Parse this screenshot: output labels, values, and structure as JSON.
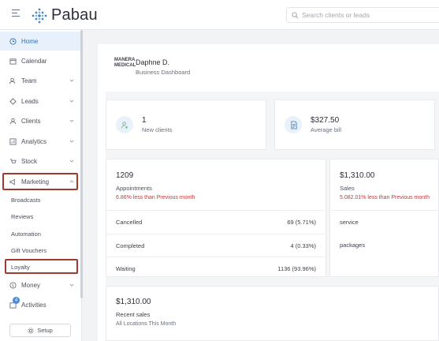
{
  "app": {
    "name": "Pabau"
  },
  "search": {
    "placeholder": "Search clients or leads"
  },
  "sidebar": {
    "items": [
      {
        "label": "Home",
        "icon": "home-icon"
      },
      {
        "label": "Calendar",
        "icon": "calendar-icon"
      },
      {
        "label": "Team",
        "icon": "team-icon"
      },
      {
        "label": "Leads",
        "icon": "leads-icon"
      },
      {
        "label": "Clients",
        "icon": "clients-icon"
      },
      {
        "label": "Analytics",
        "icon": "analytics-icon"
      },
      {
        "label": "Stock",
        "icon": "stock-icon"
      },
      {
        "label": "Marketing",
        "icon": "megaphone-icon"
      }
    ],
    "marketing_sub": [
      "Broadcasts",
      "Reviews",
      "Automation",
      "Gift Vouchers",
      "Loyalty"
    ],
    "money": {
      "label": "Money",
      "icon": "money-icon"
    },
    "activities": {
      "label": "Activities",
      "badge": "4"
    },
    "setup_label": "Setup"
  },
  "header": {
    "company_logo": "MANERA MEDICAL",
    "user_name": "Daphne D.",
    "subtitle": "Business Dashboard"
  },
  "stats": {
    "new_clients": {
      "value": "1",
      "label": "New clients"
    },
    "average_bill": {
      "value": "$327.50",
      "label": "Average bill"
    }
  },
  "appointments": {
    "value": "1209",
    "label": "Appointments",
    "change": "6.86% less than Previous month",
    "rows": [
      {
        "label": "Cancelled",
        "value": "69 (5.71%)"
      },
      {
        "label": "Completed",
        "value": "4 (0.33%)"
      },
      {
        "label": "Waiting",
        "value": "1136 (93.96%)"
      }
    ]
  },
  "sales": {
    "value": "$1,310.00",
    "label": "Sales",
    "change": "5.082.01% less than Previous month",
    "rows": [
      {
        "label": "service"
      },
      {
        "label": "packages"
      }
    ]
  },
  "recent_sales": {
    "value": "$1,310.00",
    "label": "Recent sales",
    "sub": "All Locations This Month"
  },
  "colors": {
    "accent": "#2e6fb5",
    "active_bg": "#e8f0fb",
    "negative": "#c6383b",
    "highlight": "#a03a2e"
  }
}
